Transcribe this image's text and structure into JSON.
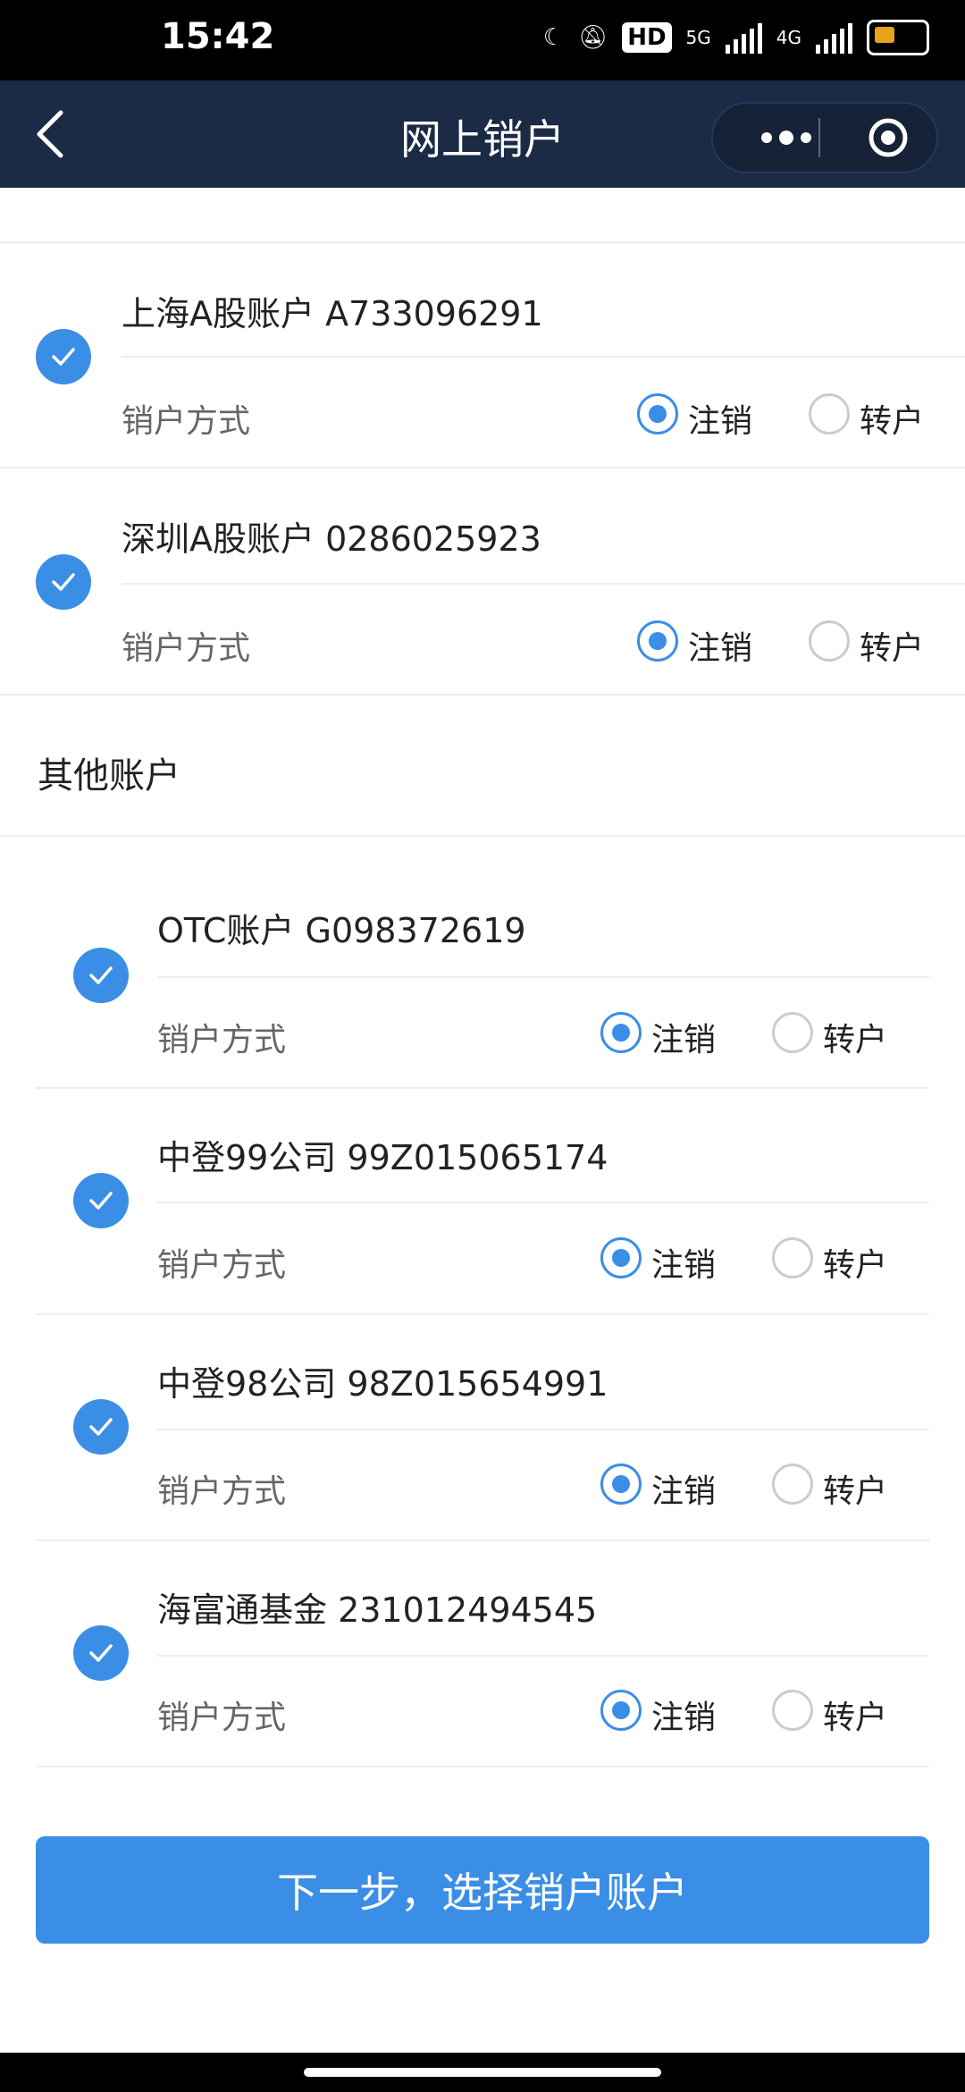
{
  "status_bar": {
    "time": "15:42",
    "hd_label": "HD",
    "net_5g": "5G",
    "net_4g": "4G"
  },
  "nav": {
    "title": "网上销户"
  },
  "icons": {
    "back": "chevron-left-icon",
    "more": "more-dots-icon",
    "close": "target-circle-icon",
    "check": "check-circle-icon"
  },
  "colors": {
    "nav_bg": "#1b2a45",
    "accent": "#3a8ee6"
  },
  "a_share_accounts": [
    {
      "name": "上海A股账户 A733096291",
      "mode_label": "销户方式",
      "option_cancel": "注销",
      "option_transfer": "转户",
      "selected": "注销"
    },
    {
      "name": "深圳A股账户 0286025923",
      "mode_label": "销户方式",
      "option_cancel": "注销",
      "option_transfer": "转户",
      "selected": "注销"
    }
  ],
  "other_section": {
    "title": "其他账户"
  },
  "other_accounts": [
    {
      "name": "OTC账户 G098372619",
      "mode_label": "销户方式",
      "option_cancel": "注销",
      "option_transfer": "转户",
      "selected": "注销"
    },
    {
      "name": "中登99公司 99Z015065174",
      "mode_label": "销户方式",
      "option_cancel": "注销",
      "option_transfer": "转户",
      "selected": "注销"
    },
    {
      "name": "中登98公司 98Z015654991",
      "mode_label": "销户方式",
      "option_cancel": "注销",
      "option_transfer": "转户",
      "selected": "注销"
    },
    {
      "name": "海富通基金 231012494545",
      "mode_label": "销户方式",
      "option_cancel": "注销",
      "option_transfer": "转户",
      "selected": "注销"
    }
  ],
  "footer": {
    "next_button": "下一步，选择销户账户"
  }
}
